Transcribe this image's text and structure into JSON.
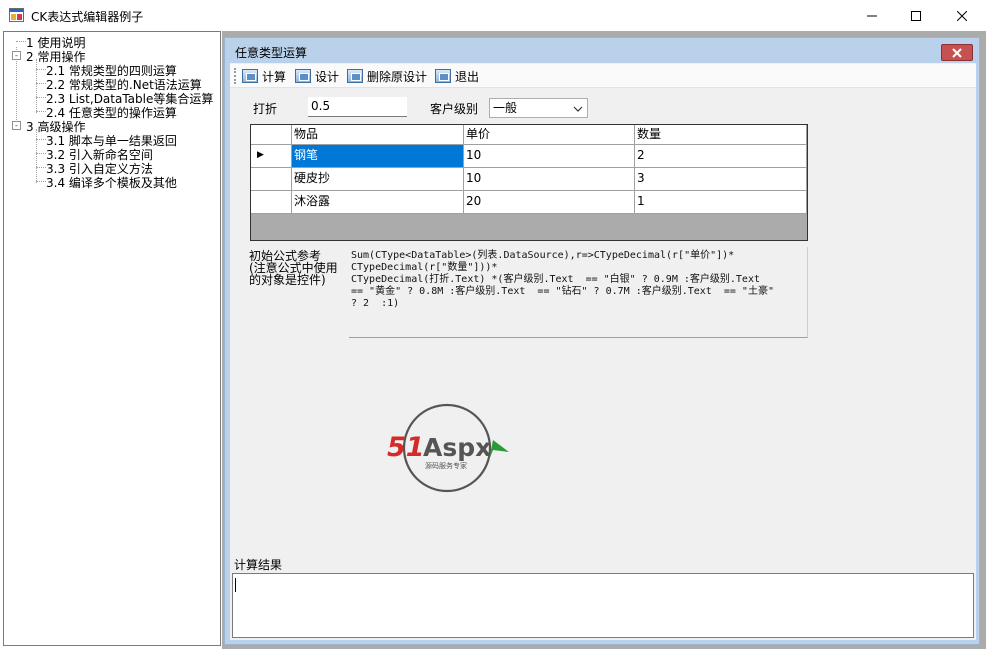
{
  "window": {
    "title": "CK表达式编辑器例子",
    "min_glyph": "—",
    "max_glyph": "☐",
    "close_glyph": "✕"
  },
  "tree": {
    "nodes": [
      {
        "label": "1 使用说明",
        "level": 0
      },
      {
        "label": "2 常用操作",
        "level": 0,
        "expander": "-"
      },
      {
        "label": "2.1 常规类型的四则运算",
        "level": 1
      },
      {
        "label": "2.2 常规类型的.Net语法运算",
        "level": 1
      },
      {
        "label": "2.3 List,DataTable等集合运算",
        "level": 1
      },
      {
        "label": "2.4 任意类型的操作运算",
        "level": 1
      },
      {
        "label": "3 高级操作",
        "level": 0,
        "expander": "-"
      },
      {
        "label": "3.1 脚本与单一结果返回",
        "level": 1
      },
      {
        "label": "3.2 引入新命名空间",
        "level": 1
      },
      {
        "label": "3.3 引入自定义方法",
        "level": 1
      },
      {
        "label": "3.4 编译多个模板及其他",
        "level": 1
      }
    ]
  },
  "child_window": {
    "title": "任意类型运算",
    "close_glyph": "✕"
  },
  "toolbar": {
    "buttons": [
      "计算",
      "设计",
      "删除原设计",
      "退出"
    ]
  },
  "form": {
    "discount_label": "打折",
    "discount_value": "0.5",
    "customer_level_label": "客户级别",
    "customer_level_value": "一般"
  },
  "grid": {
    "columns": [
      "物品",
      "单价",
      "数量"
    ],
    "rows": [
      [
        "钢笔",
        "10",
        "2"
      ],
      [
        "硬皮抄",
        "10",
        "3"
      ],
      [
        "沐浴露",
        "20",
        "1"
      ]
    ],
    "current_row_marker": "▶"
  },
  "formula": {
    "label": "初始公式参考\n(注意公式中使用的对象是控件)",
    "text": "Sum(CType<DataTable>(列表.DataSource),r=>CTypeDecimal(r[\"单价\"])*\nCTypeDecimal(r[\"数量\"]))*\nCTypeDecimal(打折.Text) *(客户级别.Text  == \"白银\" ? 0.9M :客户级别.Text\n== \"黄金\" ? 0.8M :客户级别.Text  == \"钻石\" ? 0.7M :客户级别.Text  == \"土豪\"\n? 2  :1)"
  },
  "logo": {
    "brand_number": "51",
    "brand_text": "Aspx",
    "tagline": "源码服务专家",
    "colors": {
      "red": "#d42a2a",
      "green": "#2a9a3a",
      "gray": "#555555"
    }
  },
  "result": {
    "label": "计算结果",
    "value": ""
  }
}
